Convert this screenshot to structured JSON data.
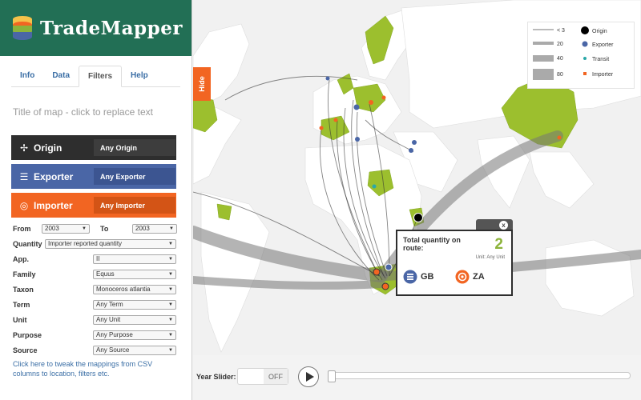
{
  "app": {
    "name": "TradeMapper"
  },
  "tabs": [
    {
      "label": "Info",
      "active": false
    },
    {
      "label": "Data",
      "active": false
    },
    {
      "label": "Filters",
      "active": true
    },
    {
      "label": "Help",
      "active": false
    }
  ],
  "map_title_placeholder": "Title of map - click to replace text",
  "filters": {
    "origin": {
      "label": "Origin",
      "value": "Any Origin",
      "icon": "crosshair-icon",
      "color": "#2e2e2e"
    },
    "exporter": {
      "label": "Exporter",
      "value": "Any Exporter",
      "icon": "list-icon",
      "color": "#4a66a6"
    },
    "importer": {
      "label": "Importer",
      "value": "Any Importer",
      "icon": "target-icon",
      "color": "#f26522"
    },
    "from_label": "From",
    "from_value": "2003",
    "to_label": "To",
    "to_value": "2003",
    "quantity_label": "Quantity",
    "quantity_value": "Importer reported quantity",
    "app_label": "App.",
    "app_value": "II",
    "family_label": "Family",
    "family_value": "Equus",
    "taxon_label": "Taxon",
    "taxon_value": "Monoceros atlantia",
    "term_label": "Term",
    "term_value": "Any Term",
    "unit_label": "Unit",
    "unit_value": "Any Unit",
    "purpose_label": "Purpose",
    "purpose_value": "Any Purpose",
    "source_label": "Source",
    "source_value": "Any Source"
  },
  "csv_link": "Click here to tweak the mappings from CSV columns to location, filters etc.",
  "hide_label": "Hide",
  "legend": {
    "widths": [
      "< 3",
      "20",
      "40",
      "80"
    ],
    "points": [
      {
        "label": "Origin",
        "color": "#000000"
      },
      {
        "label": "Exporter",
        "color": "#4a66a6"
      },
      {
        "label": "Transit",
        "color": "#2aa8a8"
      },
      {
        "label": "Importer",
        "color": "#f26522"
      }
    ]
  },
  "popup": {
    "close": "x",
    "title": "Total quantity on route:",
    "quantity": "2",
    "unit": "Unit: Any Unit",
    "from_country": "GB",
    "to_country": "ZA"
  },
  "slider": {
    "label": "Year Slider:",
    "toggle": "OFF"
  },
  "colors": {
    "brand": "#226f55",
    "land_highlight": "#9cbf2e",
    "land": "#ffffff",
    "ocean": "#f1f1f1"
  }
}
